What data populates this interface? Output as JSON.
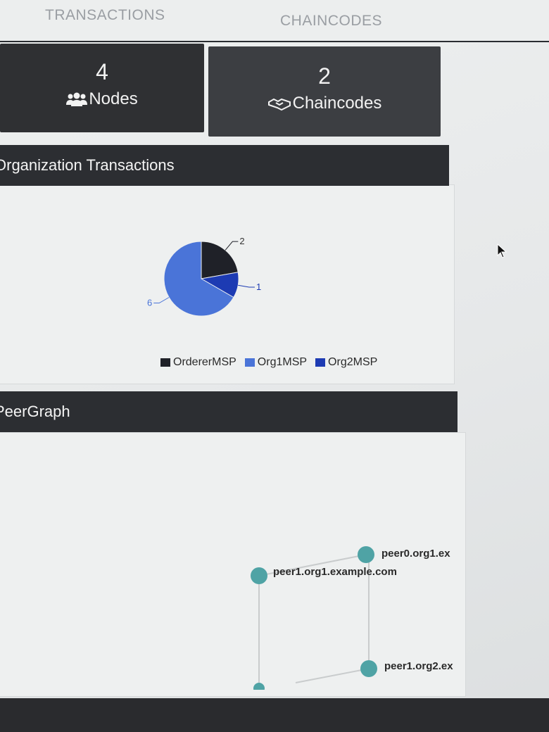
{
  "nav": {
    "tabs": [
      {
        "label": "TRANSACTIONS"
      },
      {
        "label": "CHAINCODES"
      }
    ]
  },
  "stats": {
    "nodes": {
      "count": "4",
      "label": "Nodes",
      "icon": "users-icon"
    },
    "chaincodes": {
      "count": "2",
      "label": "Chaincodes",
      "icon": "handshake-icon"
    }
  },
  "org_panel": {
    "title": "Organization Transactions"
  },
  "peer_panel": {
    "title": "PeerGraph"
  },
  "chart_data": {
    "type": "pie",
    "slices": [
      {
        "name": "OrdererMSP",
        "value": 2,
        "color": "#1f2128"
      },
      {
        "name": "Org1MSP",
        "value": 6,
        "color": "#4a74d8"
      },
      {
        "name": "Org2MSP",
        "value": 1,
        "color": "#1d3bb3"
      }
    ],
    "data_labels": [
      "2",
      "6",
      "1"
    ],
    "legend": [
      "OrdererMSP",
      "Org1MSP",
      "Org2MSP"
    ],
    "legend_position": "bottom"
  },
  "peer_graph": {
    "nodes": [
      {
        "id": "peer0.org1.ex",
        "label": "peer0.org1.ex"
      },
      {
        "id": "peer1.org1.example.com",
        "label": "peer1.org1.example.com"
      },
      {
        "id": "peer1.org2.ex",
        "label": "peer1.org2.ex"
      }
    ],
    "node_color": "#4fa3a5"
  }
}
